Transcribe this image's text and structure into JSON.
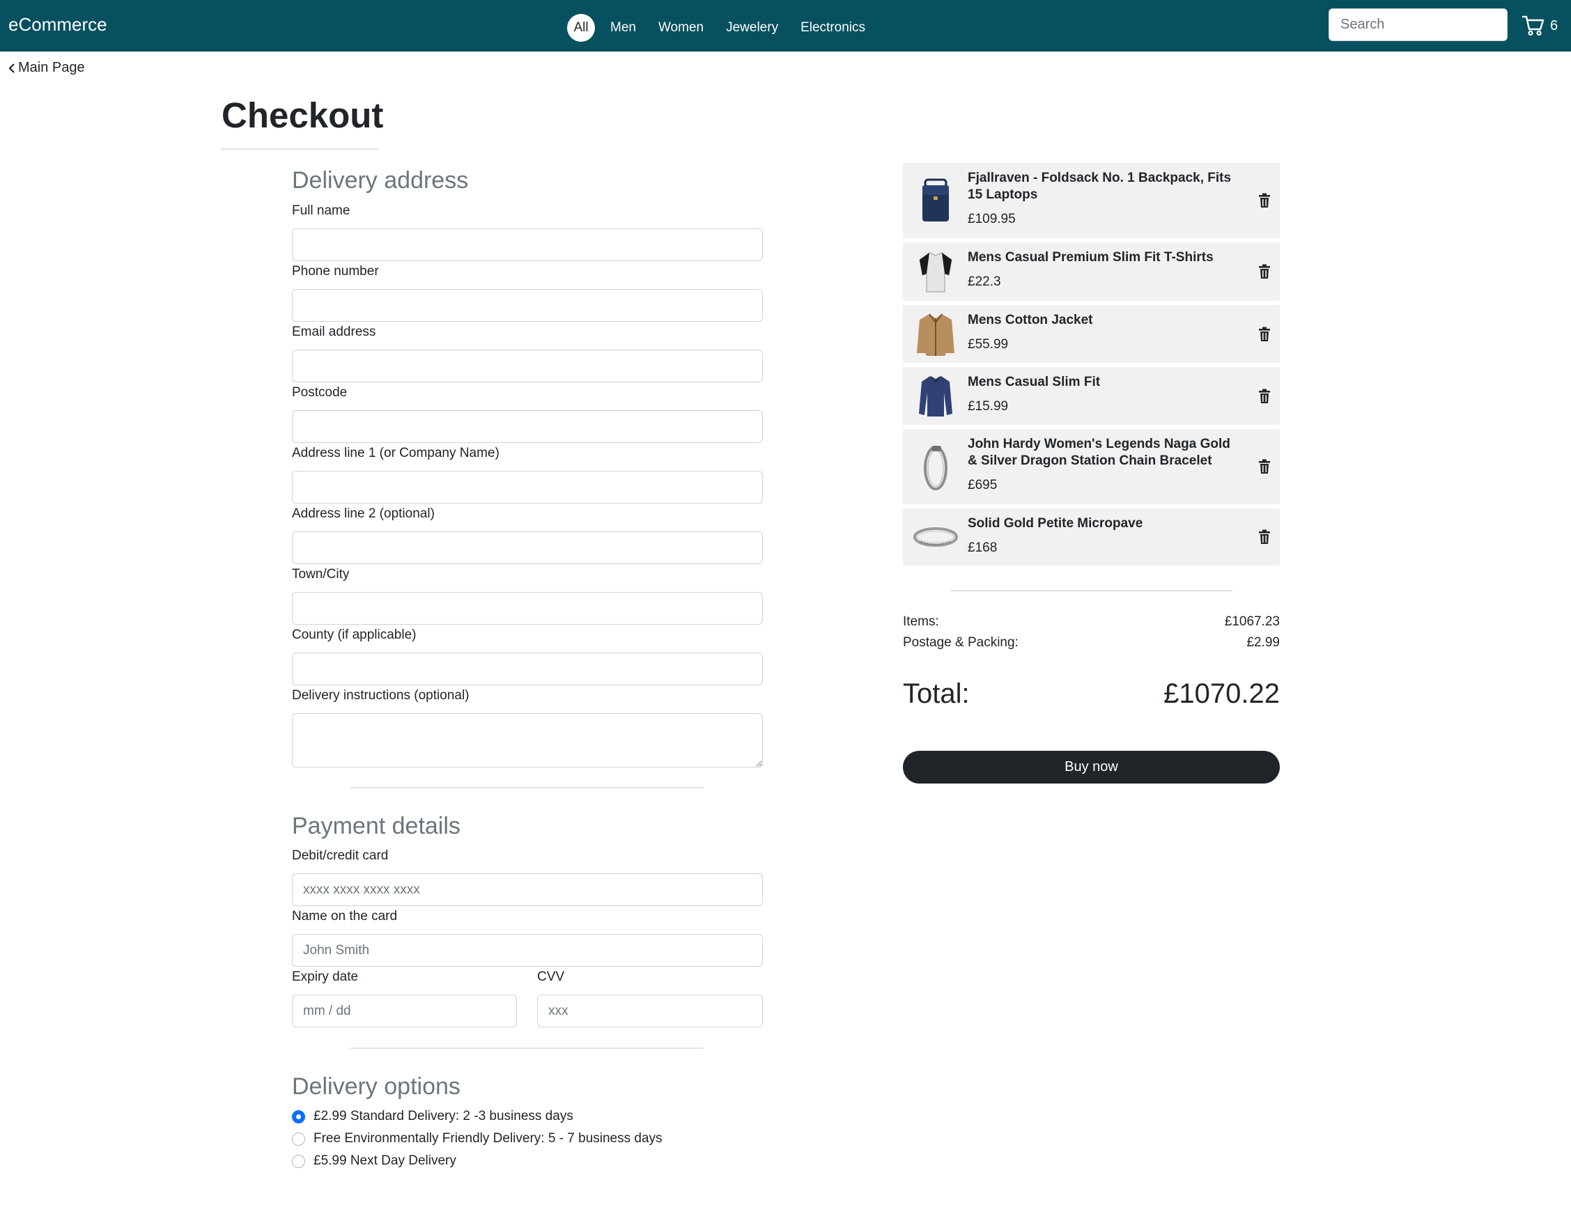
{
  "nav": {
    "brand": "eCommerce",
    "links": [
      "All",
      "Men",
      "Women",
      "Jewelery",
      "Electronics"
    ],
    "active_link": "All",
    "search_placeholder": "Search",
    "cart_count": "6"
  },
  "back_link": "Main Page",
  "page_title": "Checkout",
  "delivery_address": {
    "heading": "Delivery address",
    "fields": [
      {
        "label": "Full name",
        "value": ""
      },
      {
        "label": "Phone number",
        "value": ""
      },
      {
        "label": "Email address",
        "value": ""
      },
      {
        "label": "Postcode",
        "value": ""
      },
      {
        "label": "Address line 1 (or Company Name)",
        "value": ""
      },
      {
        "label": "Address line 2 (optional)",
        "value": ""
      },
      {
        "label": "Town/City",
        "value": ""
      },
      {
        "label": "County (if applicable)",
        "value": ""
      },
      {
        "label": "Delivery instructions (optional)",
        "value": ""
      }
    ]
  },
  "payment": {
    "heading": "Payment details",
    "card_label": "Debit/credit card",
    "card_placeholder": "xxxx xxxx xxxx xxxx",
    "name_label": "Name on the card",
    "name_placeholder": "John Smith",
    "expiry_label": "Expiry date",
    "expiry_placeholder": "mm / dd",
    "cvv_label": "CVV",
    "cvv_placeholder": "xxx"
  },
  "delivery_options": {
    "heading": "Delivery options",
    "options": [
      {
        "label": "£2.99 Standard Delivery: 2 -3 business days",
        "checked": true
      },
      {
        "label": "Free Environmentally Friendly Delivery: 5 - 7 business days",
        "checked": false
      },
      {
        "label": "£5.99 Next Day Delivery",
        "checked": false
      }
    ]
  },
  "cart": {
    "items": [
      {
        "name": "Fjallraven - Foldsack No. 1 Backpack, Fits 15 Laptops",
        "price": "£109.95",
        "icon": "backpack-icon"
      },
      {
        "name": "Mens Casual Premium Slim Fit T-Shirts",
        "price": "£22.3",
        "icon": "tshirt-icon"
      },
      {
        "name": "Mens Cotton Jacket",
        "price": "£55.99",
        "icon": "jacket-icon"
      },
      {
        "name": "Mens Casual Slim Fit",
        "price": "£15.99",
        "icon": "longsleeve-icon"
      },
      {
        "name": "John Hardy Women's Legends Naga Gold & Silver Dragon Station Chain Bracelet",
        "price": "£695",
        "icon": "bracelet-icon"
      },
      {
        "name": "Solid Gold Petite Micropave",
        "price": "£168",
        "icon": "ring-icon"
      }
    ]
  },
  "summary": {
    "items_label": "Items:",
    "items_value": "£1067.23",
    "postage_label": "Postage & Packing:",
    "postage_value": "£2.99",
    "total_label": "Total:",
    "total_value": "£1070.22",
    "buy_label": "Buy now"
  }
}
